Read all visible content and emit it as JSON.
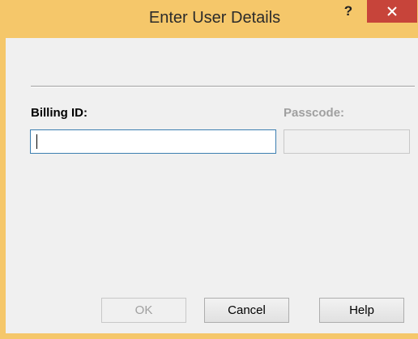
{
  "window": {
    "title": "Enter User Details",
    "help_label": "?",
    "close_label": "×"
  },
  "form": {
    "billing_id_label": "Billing ID:",
    "billing_id_value": "",
    "passcode_label": "Passcode:",
    "passcode_value": ""
  },
  "buttons": {
    "ok_label": "OK",
    "cancel_label": "Cancel",
    "help_label": "Help"
  },
  "colors": {
    "titlebar": "#f5c76a",
    "close_button": "#c7443a",
    "input_focus_border": "#3c7fb1"
  }
}
